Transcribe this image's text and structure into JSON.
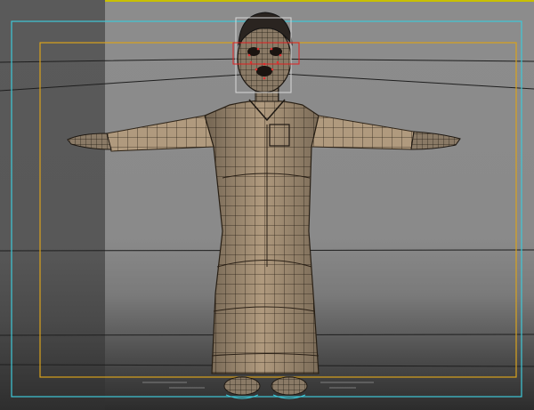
{
  "viewport": {
    "description_label": "",
    "colors": {
      "background": "#8a8a8a",
      "left_panel": "#585858",
      "safe_frame_outer": "#3ec8d8",
      "safe_frame_inner": "#d9a21c",
      "viewport_border_top": "#c8c000",
      "selection_box": "#e02020",
      "head_bbox": "#d8d8d8",
      "robe_fill": "#b49c80",
      "robe_wire": "#2e2418",
      "floor_lines": "#1e1e1e"
    },
    "objects": [
      {
        "name": "character-mesh",
        "kind": "polygon-model",
        "pose": "T-pose"
      },
      {
        "name": "head-selection",
        "kind": "bounding-box"
      },
      {
        "name": "face-selection",
        "kind": "selection-box"
      }
    ]
  }
}
